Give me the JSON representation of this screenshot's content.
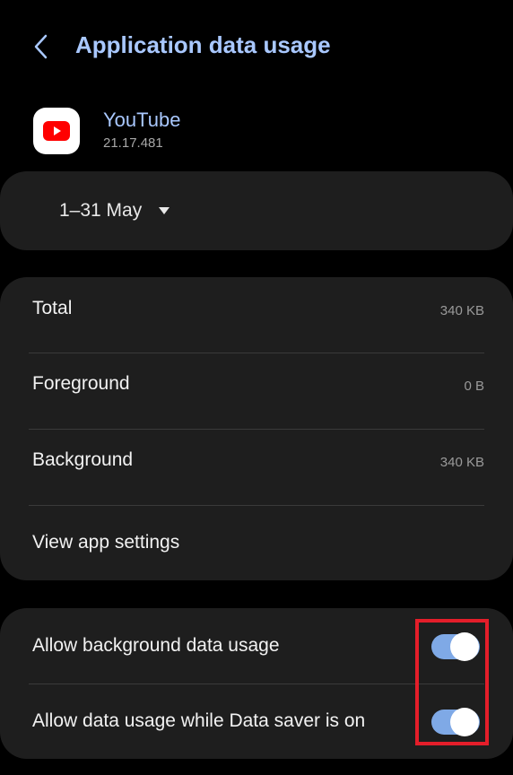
{
  "header": {
    "title": "Application data usage",
    "back_icon": "chevron-left-icon"
  },
  "app": {
    "name": "YouTube",
    "version": "21.17.481",
    "icon": "youtube-icon",
    "brand_color": "#ff0000"
  },
  "period": {
    "label": "1–31 May",
    "dropdown_icon": "caret-down-icon"
  },
  "usage": {
    "rows": [
      {
        "label": "Total",
        "value": "340 KB"
      },
      {
        "label": "Foreground",
        "value": "0 B"
      },
      {
        "label": "Background",
        "value": "340 KB"
      },
      {
        "label": "View app settings"
      }
    ]
  },
  "toggles": [
    {
      "label": "Allow background data usage",
      "on": true
    },
    {
      "label": "Allow data usage while Data saver is on",
      "on": true
    }
  ],
  "colors": {
    "accent": "#a9c8ff",
    "toggle_on": "#7fa9e6",
    "highlight": "#e41e2a",
    "card_bg": "#1e1e1e"
  }
}
